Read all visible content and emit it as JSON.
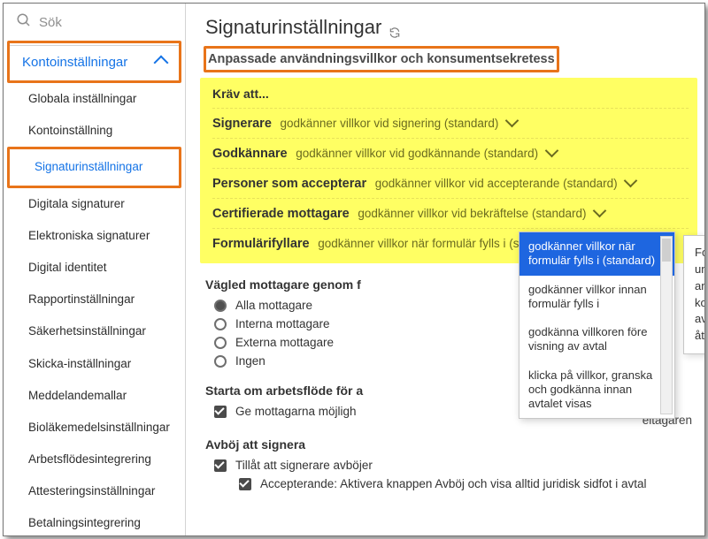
{
  "search": {
    "placeholder": "Sök"
  },
  "sidebar": {
    "header": "Kontoinställningar",
    "items": [
      "Globala inställningar",
      "Kontoinställning",
      "Signaturinställningar",
      "Digitala signaturer",
      "Elektroniska signaturer",
      "Digital identitet",
      "Rapportinställningar",
      "Säkerhetsinställningar",
      "Skicka-inställningar",
      "Meddelandemallar",
      "Bioläkemedelsinställningar",
      "Arbetsflödesintegrering",
      "Attesteringsinställningar",
      "Betalningsintegrering"
    ],
    "highlighted_index": 2
  },
  "page": {
    "title": "Signaturinställningar"
  },
  "terms": {
    "heading": "Anpassade användningsvillkor och konsumentsekretess",
    "require_label": "Kräv att...",
    "rows": [
      {
        "role": "Signerare",
        "text": "godkänner villkor vid signering (standard)"
      },
      {
        "role": "Godkännare",
        "text": "godkänner villkor vid godkännande (standard)"
      },
      {
        "role": "Personer som accepterar",
        "text": "godkänner villkor vid accepterande (standard)"
      },
      {
        "role": "Certifierade mottagare",
        "text": "godkänner villkor vid bekräftelse (standard)"
      },
      {
        "role": "Formulärifyllare",
        "text": "godkänner villkor när formulär fylls i (standard)"
      }
    ]
  },
  "dropdown": {
    "options": [
      "godkänner villkor när formulär fylls i (standard)",
      "godkänner villkor innan formulär fylls i",
      "godkänna villkoren före visning av avtal",
      "klicka på villkor, granska och godkänna innan avtalet visas"
    ],
    "selected_index": 0
  },
  "tooltip": "Formulärifyllare godkänner underförstått användningsvillkoren och konsumentsekretessen när avtalet fylls i. Ingen vidare åtgärd krävs.",
  "guided": {
    "heading_prefix": "Vägled mottagare genom f",
    "options": [
      "Alla mottagare",
      "Interna mottagare",
      "Externa mottagare",
      "Ingen"
    ],
    "selected_index": 0
  },
  "restart": {
    "heading_prefix": "Starta om arbetsflöde för a",
    "checkbox_prefix": "Ge mottagarna möjligh",
    "right_fragment": "eltagaren"
  },
  "decline": {
    "heading": "Avböj att signera",
    "allow": "Tillåt att signerare avböjer",
    "sub": "Accepterande: Aktivera knappen Avböj och visa alltid juridisk sidfot i avtal"
  }
}
